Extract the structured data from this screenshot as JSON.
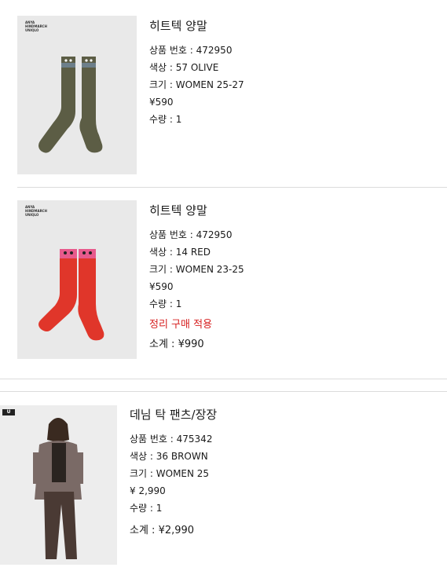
{
  "items": [
    {
      "brand": "ANYA HINDMARCH UNIQLO",
      "name": "히트텍 양말",
      "product_no": "상품 번호 : 472950",
      "color": "색상 : 57 OLIVE",
      "size": "크기 : WOMEN 25-27",
      "price": "¥590",
      "qty": "수량 : 1",
      "sock_color": "#5c5d45",
      "stripe_color": "#6d7f8a"
    },
    {
      "brand": "ANYA HINDMARCH UNIQLO",
      "name": "히트텍 양말",
      "product_no": "상품 번호 : 472950",
      "color": "색상 : 14 RED",
      "size": "크기 : WOMEN 23-25",
      "price": "¥590",
      "qty": "수량 : 1",
      "promo": "정리 구매 적용",
      "subtotal": "소계 : ¥990",
      "sock_color": "#e0362a",
      "stripe_color": "#e85a8c"
    },
    {
      "brand": "UNIQLO U",
      "name": "데님 탁 팬츠/장장",
      "product_no": "상품 번호 : 475342",
      "color": "색상 : 36 BROWN",
      "size": "크기 : WOMEN 25",
      "price": "¥ 2,990",
      "qty": "수량 : 1",
      "subtotal": "소계 : ¥2,990"
    }
  ],
  "colors": {
    "promo": "#d62020",
    "divider": "#dcdcdc",
    "thumb_bg": "#e9e9e9"
  }
}
